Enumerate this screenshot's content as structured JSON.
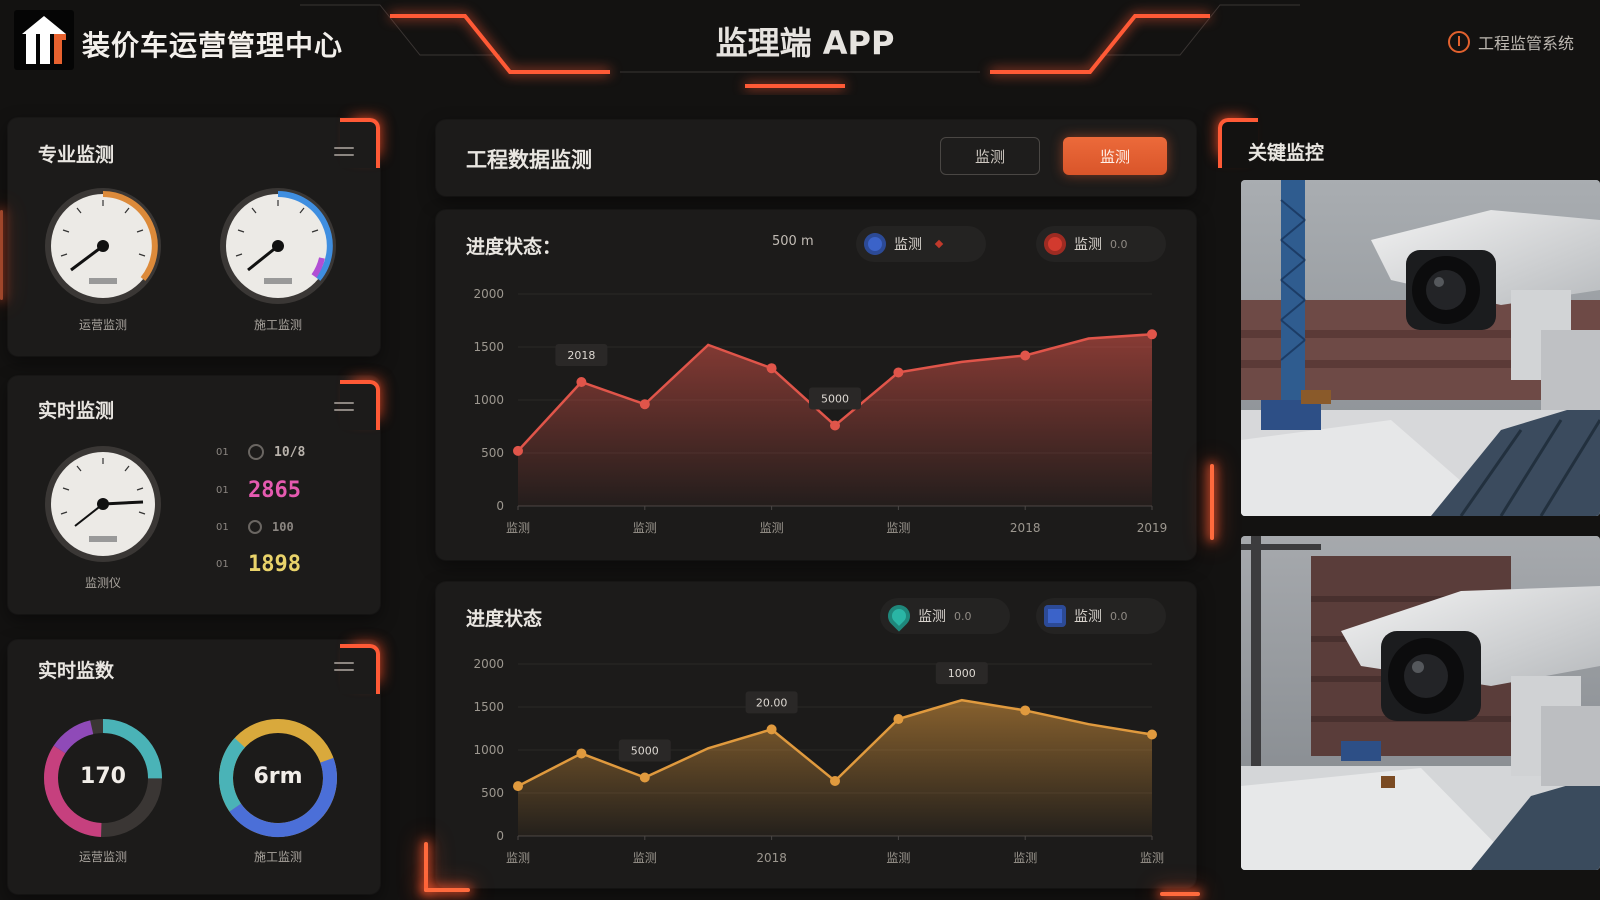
{
  "header": {
    "brand_title": "装价车运营管理中心",
    "app_title": "监理端 APP",
    "right_status": "工程监管系统"
  },
  "left": {
    "panel1": {
      "title": "专业监测",
      "gauge1_caption": "运营监测",
      "gauge2_caption": "施工监测"
    },
    "panel2": {
      "title": "实时监测",
      "gauge_caption": "监测仪",
      "stats": [
        {
          "label": "01",
          "value": "10/8",
          "color": "#b8b2ab"
        },
        {
          "label": "01",
          "value": "2865",
          "color": "#e55ab0"
        },
        {
          "label": "01",
          "value": "100",
          "color": "#8b8681"
        },
        {
          "label": "01",
          "value": "1898",
          "color": "#e9d36a"
        }
      ]
    },
    "panel3": {
      "title": "实时监数",
      "donut1_value": "170",
      "donut1_caption": "运营监测",
      "donut2_value": "6rm",
      "donut2_caption": "施工监测"
    }
  },
  "center": {
    "title": "工程数据监测",
    "btn_secondary": "监测",
    "btn_primary": "监测",
    "chart1": {
      "title": "进度状态：",
      "summary": "500 m",
      "legend": [
        {
          "label": "监测",
          "sub": "",
          "color": "#3b63c9"
        },
        {
          "label": "监测",
          "sub": "0.0",
          "color": "#d23a2e"
        }
      ]
    },
    "chart2": {
      "title": "进度状态",
      "legend": [
        {
          "label": "监测",
          "sub": "0.0",
          "color": "#2ab5a5"
        },
        {
          "label": "监测",
          "sub": "0.0",
          "color": "#3b63c9"
        }
      ]
    }
  },
  "right": {
    "title": "关键监控"
  },
  "chart_data": [
    {
      "type": "area",
      "title": "进度状态：",
      "color": "#e0554a",
      "ylim": [
        0,
        2000
      ],
      "yticks": [
        "0",
        "500",
        "1000",
        "1500",
        "2000"
      ],
      "categories": [
        "监测",
        "监测",
        "监测",
        "监测",
        "2018",
        "2019"
      ],
      "x": [
        0,
        1,
        2,
        3,
        4,
        5,
        6,
        7,
        8,
        9,
        10
      ],
      "values": [
        520,
        1170,
        960,
        1520,
        1300,
        760,
        1260,
        1360,
        1420,
        1580,
        1620
      ],
      "annotations": [
        {
          "index": 1,
          "text": "2018"
        },
        {
          "index": 5,
          "text": "5000"
        }
      ]
    },
    {
      "type": "area",
      "title": "进度状态",
      "color": "#e09a3e",
      "ylim": [
        0,
        2000
      ],
      "yticks": [
        "0",
        "500",
        "1000",
        "1500",
        "2000"
      ],
      "categories": [
        "监测",
        "监测",
        "2018",
        "监测",
        "监测",
        "监测"
      ],
      "x": [
        0,
        1,
        2,
        3,
        4,
        5,
        6,
        7,
        8,
        9,
        10
      ],
      "values": [
        580,
        960,
        680,
        1020,
        1240,
        640,
        1360,
        1580,
        1460,
        1300,
        1180
      ],
      "annotations": [
        {
          "index": 2,
          "text": "5000"
        },
        {
          "index": 4,
          "text": "20.00"
        },
        {
          "index": 7,
          "text": "1000"
        }
      ]
    }
  ]
}
